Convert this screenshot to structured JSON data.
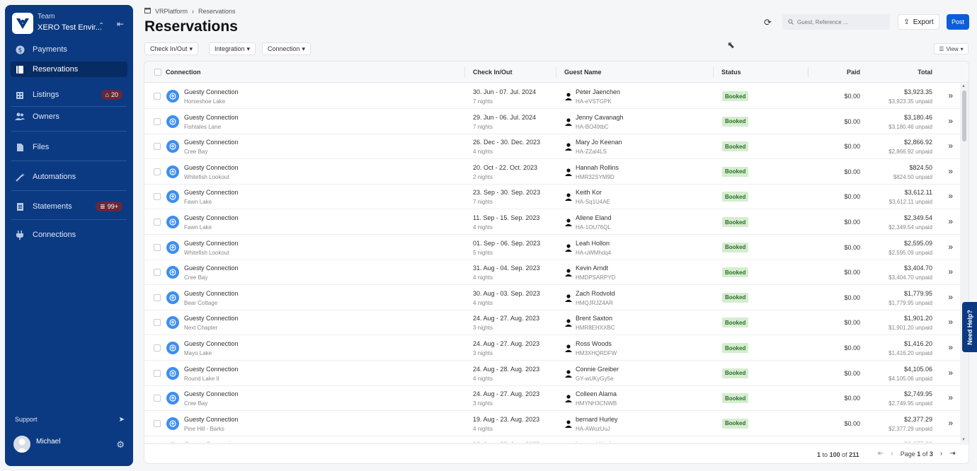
{
  "sidebar": {
    "team_label": "Team",
    "team_name": "XERO Test Envir...",
    "items": [
      {
        "label": "Payments",
        "icon": "dollar-circle-icon"
      },
      {
        "label": "Reservations",
        "icon": "book-icon",
        "active": true
      },
      {
        "label": "Listings",
        "icon": "building-icon",
        "badge": "20"
      },
      {
        "label": "Owners",
        "icon": "users-icon"
      },
      {
        "label": "Files",
        "icon": "file-icon"
      },
      {
        "label": "Automations",
        "icon": "wand-icon"
      },
      {
        "label": "Statements",
        "icon": "document-icon",
        "badge": "99+"
      },
      {
        "label": "Connections",
        "icon": "plug-icon"
      }
    ],
    "support_label": "Support",
    "user_name": "Michael"
  },
  "breadcrumb": {
    "root": "VRPlatform",
    "current": "Reservations"
  },
  "page_title": "Reservations",
  "toolbar": {
    "search_placeholder": "Guest, Reference ...",
    "export_label": "Export",
    "post_label": "Post",
    "view_label": "View"
  },
  "filters": [
    "Check In/Out",
    "Integration",
    "Connection"
  ],
  "table": {
    "headers": {
      "connection": "Connection",
      "check": "Check In/Out",
      "guest": "Guest Name",
      "status": "Status",
      "paid": "Paid",
      "total": "Total"
    },
    "rows": [
      {
        "conn": "Guesty Connection",
        "listing": "Horseshoe Lake",
        "dates": "30. Jun - 07. Jul. 2024",
        "nights": "7 nights",
        "guest": "Peter Jaenchen",
        "ref": "HA-eVSTGPK",
        "status": "Booked",
        "paid": "$0.00",
        "total": "$3,923.35",
        "unpaid": "$3,923.35 unpaid"
      },
      {
        "conn": "Guesty Connection",
        "listing": "Fishtales Lane",
        "dates": "29. Jun - 06. Jul. 2024",
        "nights": "7 nights",
        "guest": "Jenny Cavanagh",
        "ref": "HA-BO49tbC",
        "status": "Booked",
        "paid": "$0.00",
        "total": "$3,180.46",
        "unpaid": "$3,180.46 unpaid"
      },
      {
        "conn": "Guesty Connection",
        "listing": "Cree Bay",
        "dates": "26. Dec - 30. Dec. 2023",
        "nights": "4 nights",
        "guest": "Mary Jo Keenan",
        "ref": "HA-ZZal4LS",
        "status": "Booked",
        "paid": "$0.00",
        "total": "$2,866.92",
        "unpaid": "$2,866.92 unpaid"
      },
      {
        "conn": "Guesty Connection",
        "listing": "Whitefish Lookout",
        "dates": "20. Oct - 22. Oct. 2023",
        "nights": "2 nights",
        "guest": "Hannah Rollins",
        "ref": "HMR32SYM9D",
        "status": "Booked",
        "paid": "$0.00",
        "total": "$824.50",
        "unpaid": "$824.50 unpaid"
      },
      {
        "conn": "Guesty Connection",
        "listing": "Fawn Lake",
        "dates": "23. Sep - 30. Sep. 2023",
        "nights": "7 nights",
        "guest": "Keith Kor",
        "ref": "HA-Sq1U4AE",
        "status": "Booked",
        "paid": "$0.00",
        "total": "$3,612.11",
        "unpaid": "$3,612.11 unpaid"
      },
      {
        "conn": "Guesty Connection",
        "listing": "Fawn Lake",
        "dates": "11. Sep - 15. Sep. 2023",
        "nights": "4 nights",
        "guest": "Allene Eland",
        "ref": "HA-1OU76QL",
        "status": "Booked",
        "paid": "$0.00",
        "total": "$2,349.54",
        "unpaid": "$2,349.54 unpaid"
      },
      {
        "conn": "Guesty Connection",
        "listing": "Whitefish Lookout",
        "dates": "01. Sep - 06. Sep. 2023",
        "nights": "5 nights",
        "guest": "Leah Hollon",
        "ref": "HA-uWMhdq4",
        "status": "Booked",
        "paid": "$0.00",
        "total": "$2,595.09",
        "unpaid": "$2,595.09 unpaid"
      },
      {
        "conn": "Guesty Connection",
        "listing": "Cree Bay",
        "dates": "31. Aug - 04. Sep. 2023",
        "nights": "4 nights",
        "guest": "Kevin Arndt",
        "ref": "HMDPSARPYD",
        "status": "Booked",
        "paid": "$0.00",
        "total": "$3,404.70",
        "unpaid": "$3,404.70 unpaid"
      },
      {
        "conn": "Guesty Connection",
        "listing": "Bear Cottage",
        "dates": "30. Aug - 03. Sep. 2023",
        "nights": "4 nights",
        "guest": "Zach Rodvold",
        "ref": "HMQJRJZ4AR",
        "status": "Booked",
        "paid": "$0.00",
        "total": "$1,779.95",
        "unpaid": "$1,779.95 unpaid"
      },
      {
        "conn": "Guesty Connection",
        "listing": "Next Chapter",
        "dates": "24. Aug - 27. Aug. 2023",
        "nights": "3 nights",
        "guest": "Brent Saxton",
        "ref": "HMR8EHXXBC",
        "status": "Booked",
        "paid": "$0.00",
        "total": "$1,901.20",
        "unpaid": "$1,901.20 unpaid"
      },
      {
        "conn": "Guesty Connection",
        "listing": "Mayo Lake",
        "dates": "24. Aug - 27. Aug. 2023",
        "nights": "3 nights",
        "guest": "Ross Woods",
        "ref": "HM3XHQRDFW",
        "status": "Booked",
        "paid": "$0.00",
        "total": "$1,416.20",
        "unpaid": "$1,416.20 unpaid"
      },
      {
        "conn": "Guesty Connection",
        "listing": "Round Lake II",
        "dates": "24. Aug - 28. Aug. 2023",
        "nights": "4 nights",
        "guest": "Connie Greiber",
        "ref": "GY-wUKyGy5e",
        "status": "Booked",
        "paid": "$0.00",
        "total": "$4,105.06",
        "unpaid": "$4,105.06 unpaid"
      },
      {
        "conn": "Guesty Connection",
        "listing": "Cree Bay",
        "dates": "24. Aug - 27. Aug. 2023",
        "nights": "3 nights",
        "guest": "Colleen Alama",
        "ref": "HMYNH3CNWB",
        "status": "Booked",
        "paid": "$0.00",
        "total": "$2,749.95",
        "unpaid": "$2,749.95 unpaid"
      },
      {
        "conn": "Guesty Connection",
        "listing": "Pine Hill - Barks",
        "dates": "19. Aug - 23. Aug. 2023",
        "nights": "4 nights",
        "guest": "bernard Hurley",
        "ref": "HA-AWozUuJ",
        "status": "Booked",
        "paid": "$0.00",
        "total": "$2,377.29",
        "unpaid": "$2,377.29 unpaid"
      }
    ]
  },
  "footer": {
    "range_start": "1",
    "range_to": "to",
    "range_end": "100",
    "range_of": "of",
    "range_total": "211",
    "page_label": "Page",
    "page_current": "1",
    "page_of": "of",
    "page_total": "3"
  },
  "help_label": "Need Help?"
}
